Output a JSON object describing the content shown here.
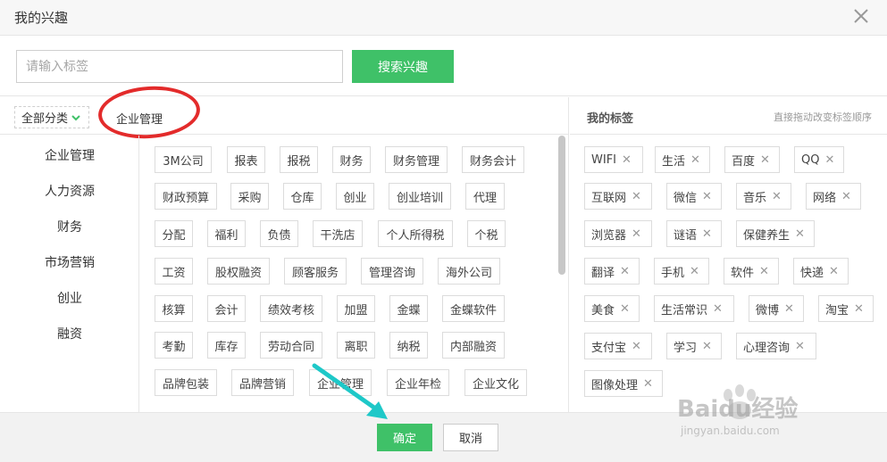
{
  "dialog": {
    "title": "我的兴趣"
  },
  "search": {
    "placeholder": "请输入标签",
    "button_label": "搜索兴趣"
  },
  "category_bar": {
    "selector_label": "全部分类",
    "current": "企业管理"
  },
  "categories": [
    "企业管理",
    "人力资源",
    "财务",
    "市场营销",
    "创业",
    "融资"
  ],
  "tag_rows": [
    [
      "3M公司",
      "报表",
      "报税",
      "财务",
      "财务管理",
      "财务会计"
    ],
    [
      "财政预算",
      "采购",
      "仓库",
      "创业",
      "创业培训",
      "代理"
    ],
    [
      "分配",
      "福利",
      "负债",
      "干洗店",
      "个人所得税",
      "个税"
    ],
    [
      "工资",
      "股权融资",
      "顾客服务",
      "管理咨询",
      "海外公司"
    ],
    [
      "核算",
      "会计",
      "绩效考核",
      "加盟",
      "金蝶",
      "金蝶软件"
    ],
    [
      "考勤",
      "库存",
      "劳动合同",
      "离职",
      "纳税",
      "内部融资"
    ],
    [
      "品牌包装",
      "品牌营销",
      "企业管理",
      "企业年检",
      "企业文化"
    ]
  ],
  "my_tags": {
    "title": "我的标签",
    "hint": "直接拖动改变标签顺序",
    "remove_symbol": "✕",
    "rows": [
      [
        "WIFI",
        "生活",
        "百度",
        "QQ"
      ],
      [
        "互联网",
        "微信",
        "音乐",
        "网络"
      ],
      [
        "浏览器",
        "谜语",
        "保健养生"
      ],
      [
        "翻译",
        "手机",
        "软件",
        "快递"
      ],
      [
        "美食",
        "生活常识",
        "微博",
        "淘宝"
      ],
      [
        "支付宝",
        "学习",
        "心理咨询"
      ],
      [
        "图像处理"
      ]
    ]
  },
  "footer": {
    "ok_label": "确定",
    "cancel_label": "取消"
  },
  "watermark": {
    "brand": "Baidu经验",
    "url": "jingyan.baidu.com"
  },
  "colors": {
    "accent_green": "#3fc168",
    "annotation_red": "#e32b2b",
    "annotation_arrow": "#1ec8c8"
  }
}
